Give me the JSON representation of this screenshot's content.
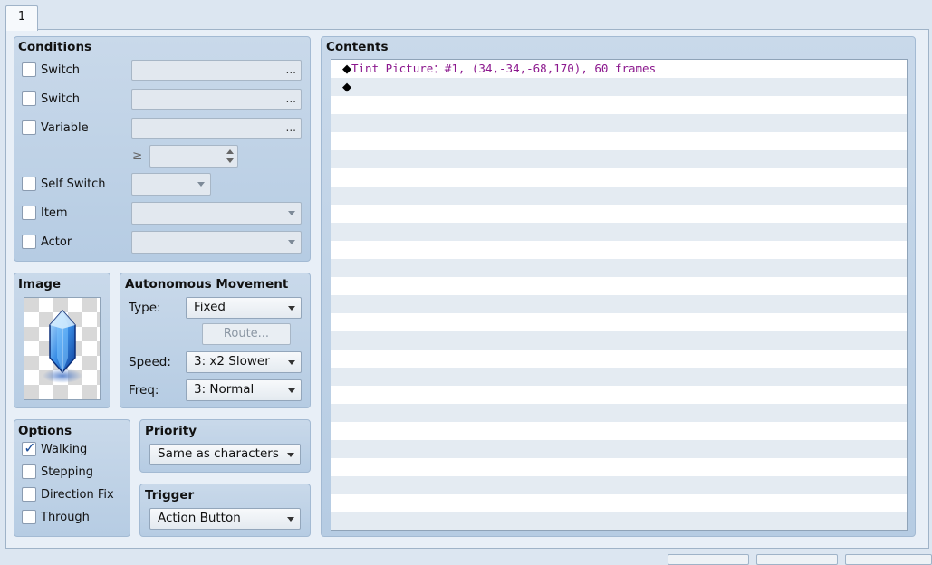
{
  "tab": {
    "label": "1"
  },
  "conditions": {
    "title": "Conditions",
    "items": [
      {
        "label": "Switch",
        "checked": false
      },
      {
        "label": "Switch",
        "checked": false
      },
      {
        "label": "Variable",
        "checked": false
      },
      {
        "label": "Self Switch",
        "checked": false
      },
      {
        "label": "Item",
        "checked": false
      },
      {
        "label": "Actor",
        "checked": false
      }
    ],
    "ellipsis": "...",
    "ge_symbol": "≥"
  },
  "image": {
    "title": "Image",
    "icon": "blue-crystal-sprite"
  },
  "autonomous_movement": {
    "title": "Autonomous Movement",
    "type_label": "Type:",
    "type_value": "Fixed",
    "route_button": "Route...",
    "speed_label": "Speed:",
    "speed_value": "3: x2 Slower",
    "freq_label": "Freq:",
    "freq_value": "3: Normal"
  },
  "options": {
    "title": "Options",
    "items": [
      {
        "label": "Walking",
        "checked": true
      },
      {
        "label": "Stepping",
        "checked": false
      },
      {
        "label": "Direction Fix",
        "checked": false
      },
      {
        "label": "Through",
        "checked": false
      }
    ]
  },
  "priority": {
    "title": "Priority",
    "value": "Same as characters"
  },
  "trigger": {
    "title": "Trigger",
    "value": "Action Button"
  },
  "contents": {
    "title": "Contents",
    "commands": [
      {
        "marker": "◆",
        "text": "Tint Picture：#1, (34,-34,-68,170), 60 frames"
      },
      {
        "marker": "◆",
        "text": ""
      }
    ]
  },
  "colors": {
    "command_text": "#8b178d",
    "stripe_alt": "#e4ebf2",
    "group_bg": "#c3d5e8"
  }
}
